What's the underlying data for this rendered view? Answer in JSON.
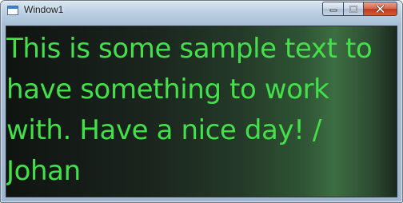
{
  "window": {
    "title": "Window1",
    "buttons": {
      "minimize": "minimize-icon",
      "maximize": "maximize-icon",
      "close": "close-icon"
    }
  },
  "content": {
    "text": "This is some sample text to have something to work with. Have a nice day! / Johan",
    "text_color": "#43e04a"
  }
}
